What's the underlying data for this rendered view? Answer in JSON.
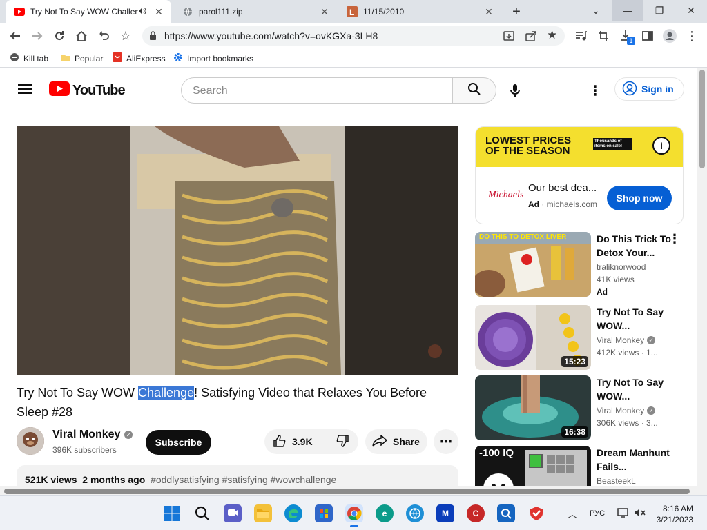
{
  "browser": {
    "tabs": [
      {
        "title": "Try Not To Say WOW Challen",
        "active": true
      },
      {
        "title": "parol111.zip",
        "active": false
      },
      {
        "title": "11/15/2010",
        "active": false
      }
    ],
    "url": "https://www.youtube.com/watch?v=ovKGXa-3LH8",
    "download_badge": "1",
    "bookmarks": [
      "Kill tab",
      "Popular",
      "AliExpress",
      "Import bookmarks"
    ]
  },
  "youtube": {
    "logo_text": "YouTube",
    "search_placeholder": "Search",
    "sign_in": "Sign in"
  },
  "video": {
    "title_before": "Try Not To Say WOW ",
    "title_highlight": "Challenge",
    "title_after": "! Satisfying Video that Relaxes You Before Sleep #28",
    "channel": "Viral Monkey",
    "subscribers": "396K subscribers",
    "subscribe_label": "Subscribe",
    "likes": "3.9K",
    "share_label": "Share",
    "views": "521K views",
    "posted": "2 months ago",
    "hashtags": "#oddlysatisfying #satisfying #wowchallenge"
  },
  "ad": {
    "banner_line1": "LOWEST PRICES",
    "banner_line2": "OF THE SEASON",
    "banner_tag": "Thousands of items on sale!",
    "headline": "Our best dea...",
    "ad_label": "Ad",
    "domain": "michaels.com",
    "brand": "Michaels",
    "cta": "Shop now"
  },
  "recommendations": [
    {
      "title": "Do This Trick To Detox Your...",
      "channel": "traliknorwood",
      "views": "41K views",
      "extra": "Ad",
      "thumb_text": "DO THIS TO DETOX LIVER",
      "duration": ""
    },
    {
      "title": "Try Not To Say WOW...",
      "channel": "Viral Monkey",
      "views": "412K views · 1...",
      "extra": "",
      "thumb_text": "",
      "duration": "15:23"
    },
    {
      "title": "Try Not To Say WOW...",
      "channel": "Viral Monkey",
      "views": "306K views · 3...",
      "extra": "",
      "thumb_text": "",
      "duration": "16:38"
    },
    {
      "title": "Dream Manhunt Fails...",
      "channel": "BeasteekL",
      "views": "",
      "extra": "",
      "thumb_text": "-100 IQ",
      "duration": ""
    }
  ],
  "taskbar": {
    "language": "РУС",
    "time": "8:16 AM",
    "date": "3/21/2023"
  }
}
